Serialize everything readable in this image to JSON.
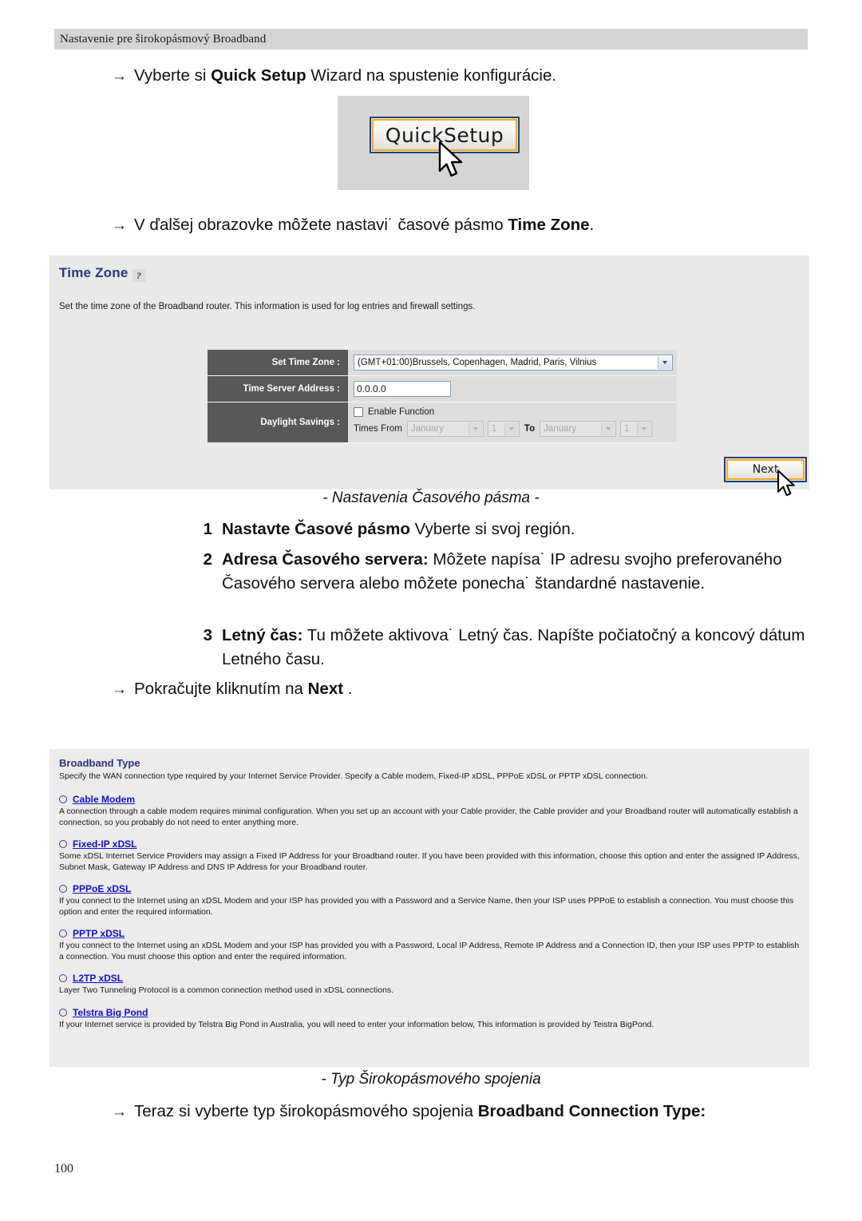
{
  "header": {
    "running_title": "Nastavenie pre širokopásmový Broadband"
  },
  "instructions": {
    "step1": {
      "arrow": "→",
      "pre": "Vyberte si ",
      "bold": "Quick Setup",
      "post": " Wizard na spustenie konfigurácie."
    },
    "step2": {
      "arrow": "→",
      "pre": "V ďalšej obrazovke môžete nastavi˙ časové pásmo ",
      "bold": "Time Zone",
      "post": "."
    },
    "step3": {
      "arrow": "→",
      "pre": "Pokračujte kliknutím na ",
      "bold": "Next",
      "post": " ."
    },
    "step4": {
      "arrow": "→",
      "pre": "Teraz si vyberte typ širokopásmového spojenia ",
      "bold": "Broadband Connection Type:",
      "post": ""
    }
  },
  "quicksetup_screenshot": {
    "button_label": "QuickSetup",
    "cursor": "mouse-pointer"
  },
  "time_zone_panel": {
    "title": "Time Zone",
    "help_icon": "?",
    "description": "Set the time zone of the Broadband router. This information is used for log entries and firewall settings.",
    "fields": {
      "set_time_zone": {
        "label": "Set Time Zone :",
        "value": "(GMT+01:00)Brussels, Copenhagen, Madrid, Paris, Vilnius"
      },
      "time_server_address": {
        "label": "Time Server Address :",
        "value": "0.0.0.0"
      },
      "daylight_savings": {
        "label": "Daylight Savings :",
        "enable_label": "Enable Function",
        "enabled": false,
        "times_from_label": "Times From",
        "from_month": "January",
        "from_day": "1",
        "to_label": "To",
        "to_month": "January",
        "to_day": "1"
      }
    },
    "next_button": "Next",
    "cursor": "mouse-pointer"
  },
  "captions": {
    "time_zone": "- Nastavenia Časového pásma -",
    "broadband": "- Typ  Širokopásmového spojenia"
  },
  "numbered_list": [
    {
      "index": "1",
      "bold": "Nastavte Časové pásmo",
      "text": " Vyberte si svoj región."
    },
    {
      "index": "2",
      "bold": "Adresa Časového servera:",
      "text": "  Môžete napísa˙ IP adresu svojho preferovaného Časového servera alebo môžete ponecha˙ štandardné nastavenie."
    },
    {
      "index": "3",
      "bold": "Letný čas:",
      "text": " Tu môžete aktivova˙ Letný čas. Napíšte počiatočný a koncový dátum Letného času."
    }
  ],
  "broadband_panel": {
    "title": "Broadband Type",
    "intro": "Specify the WAN connection type required by your Internet Service Provider. Specify a Cable modem, Fixed-IP xDSL, PPPoE xDSL or PPTP xDSL connection.",
    "options": [
      {
        "label": "Cable Modem",
        "selected": false,
        "description": "A connection through a cable modem requires minimal configuration. When you set up an account with your Cable provider, the Cable provider and your Broadband router will automatically establish a connection, so you probably do not need to enter anything more."
      },
      {
        "label": "Fixed-IP xDSL",
        "selected": false,
        "description": "Some xDSL Internet Service Providers may assign a Fixed IP Address for your Broadband router. If you have been provided with this information, choose this option and enter the assigned IP Address, Subnet Mask, Gateway IP Address and DNS IP Address for your Broadband router."
      },
      {
        "label": "PPPoE xDSL",
        "selected": false,
        "description": "If you connect to the Internet using an xDSL Modem and your ISP has provided you with a Password and a Service Name, then your ISP uses PPPoE to establish a connection. You must choose this option and enter the required information."
      },
      {
        "label": "PPTP xDSL",
        "selected": false,
        "description": "If you connect to the Internet using an xDSL Modem and your ISP has provided you with a Password, Local IP Address, Remote IP Address and a Connection ID, then your ISP uses PPTP to establish a connection. You must choose this option and enter the required information."
      },
      {
        "label": "L2TP xDSL",
        "selected": false,
        "description": "Layer Two Tunneling Protocol is a common connection method used in xDSL connections."
      },
      {
        "label": "Telstra Big Pond",
        "selected": false,
        "description": "If your Internet service is provided by Telstra Big Pond in Australia, you will need to enter your information below, This information is provided by Teistra BigPond."
      }
    ]
  },
  "footer": {
    "page_number": "100"
  },
  "colors": {
    "header_bar": "#d4d4d4",
    "panel_bg": "#e9e9e9",
    "panel_title": "#2b3380",
    "field_label_bg": "#585858",
    "link_blue": "#1010c8",
    "button_border_orange": "#f0a825",
    "button_border_blue": "#1f3f77"
  }
}
